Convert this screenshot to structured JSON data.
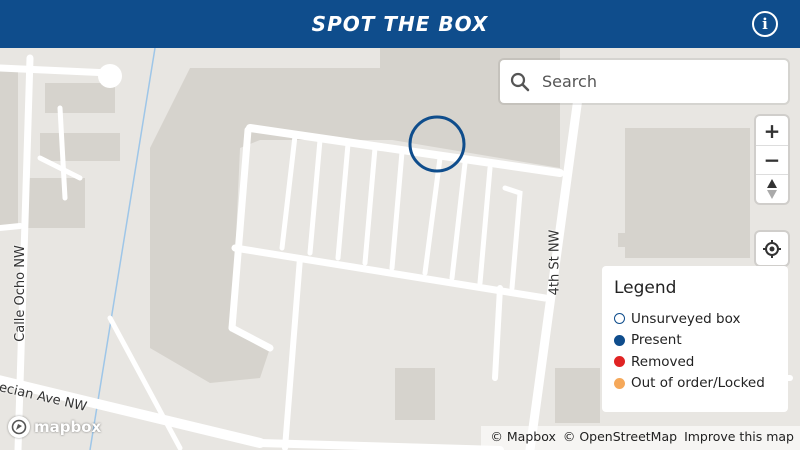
{
  "header": {
    "title": "SPOT THE BOX",
    "info_icon": "info-icon"
  },
  "search": {
    "placeholder": "Search",
    "icon": "search-icon"
  },
  "controls": {
    "zoom_in": "+",
    "zoom_out": "−",
    "compass_icon": "compass-icon",
    "locate_icon": "geolocate-icon"
  },
  "legend": {
    "title": "Legend",
    "items": [
      {
        "label": "Unsurveyed box",
        "fill": "#ffffff",
        "border": "#0f4d8c"
      },
      {
        "label": "Present",
        "fill": "#0f4d8c",
        "border": "#0f4d8c"
      },
      {
        "label": "Removed",
        "fill": "#e02424",
        "border": "#e02424"
      },
      {
        "label": "Out of order/Locked",
        "fill": "#f5a85a",
        "border": "#f5a85a"
      }
    ]
  },
  "streets": {
    "calle_ocho": "Calle Ocho NW",
    "fourth_st": "4th St NW",
    "ecian_ave": "ecian Ave NW"
  },
  "attribution": {
    "mapbox": "© Mapbox",
    "osm": "© OpenStreetMap",
    "improve": "Improve this map"
  },
  "logo": {
    "text": "mapbox"
  },
  "colors": {
    "brand": "#0f4d8c",
    "map_bg": "#e8e6e2",
    "building": "#d6d3cd",
    "road": "#ffffff",
    "water": "#9ec6e8"
  }
}
